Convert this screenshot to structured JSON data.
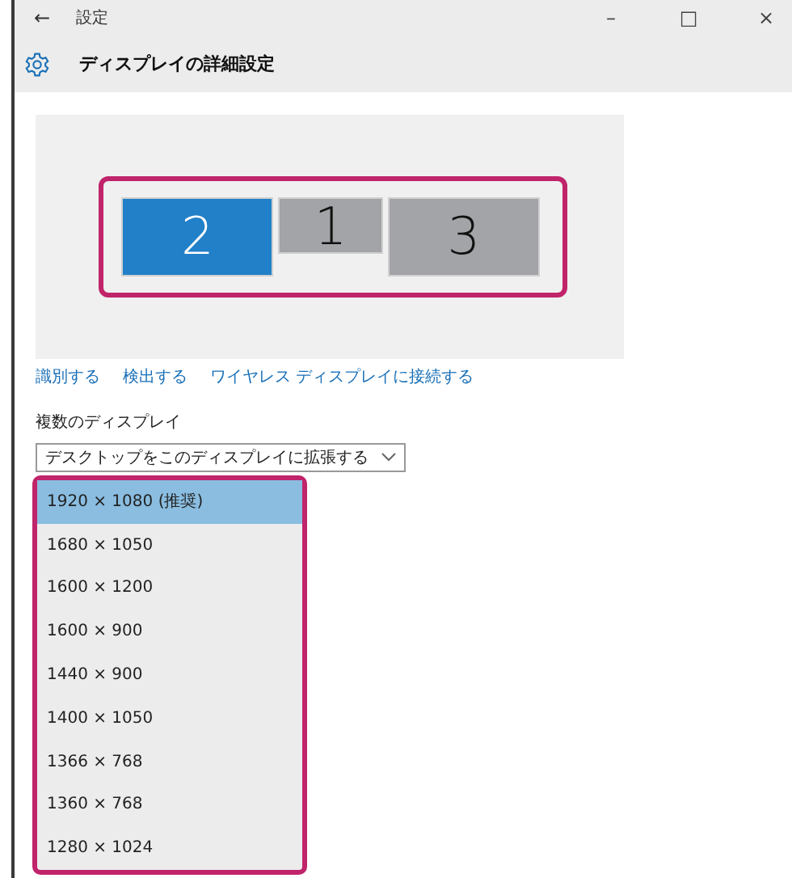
{
  "window": {
    "back": "←",
    "title": "設定",
    "controls": [
      "–",
      "□",
      "×"
    ]
  },
  "header": {
    "title": "ディスプレイの詳細設定"
  },
  "monitors": [
    {
      "label": "2",
      "selected": true
    },
    {
      "label": "1",
      "selected": false
    },
    {
      "label": "3",
      "selected": false
    }
  ],
  "links": [
    "識別する",
    "検出する",
    "ワイヤレス ディスプレイに接続する"
  ],
  "multiple_displays": {
    "label": "複数のディスプレイ",
    "value": "デスクトップをこのディスプレイに拡張する"
  },
  "resolutions": [
    {
      "label": "1920 × 1080 (推奨)",
      "selected": true
    },
    {
      "label": "1680 × 1050",
      "selected": false
    },
    {
      "label": "1600 × 1200",
      "selected": false
    },
    {
      "label": "1600 × 900",
      "selected": false
    },
    {
      "label": "1440 × 900",
      "selected": false
    },
    {
      "label": "1400 × 1050",
      "selected": false
    },
    {
      "label": "1366 × 768",
      "selected": false
    },
    {
      "label": "1360 × 768",
      "selected": false
    },
    {
      "label": "1280 × 1024",
      "selected": false
    }
  ]
}
